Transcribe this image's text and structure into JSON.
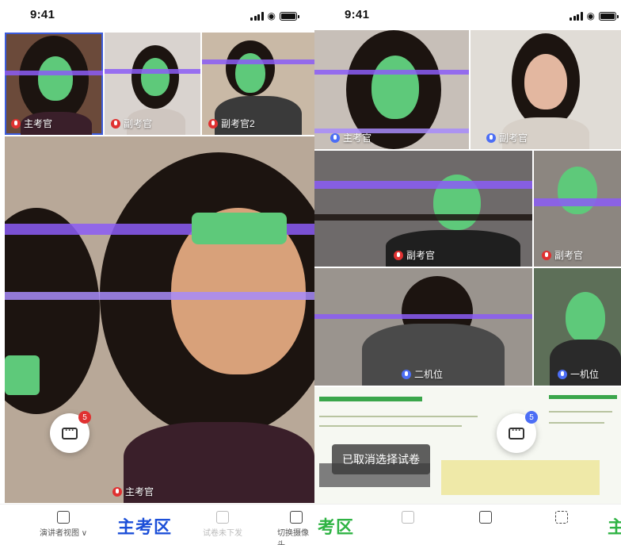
{
  "status": {
    "time": "9:41"
  },
  "left": {
    "tiles": [
      {
        "label": "主考官"
      },
      {
        "label": "副考官"
      },
      {
        "label": "副考官2"
      }
    ],
    "main_label": "主考官",
    "chat_badge": "5",
    "tabbar": {
      "view_label": "演讲者视图",
      "view_arrow": "∨",
      "zone_title": "主考区",
      "paper_label": "试卷未下发",
      "camera_label": "切换摄像头"
    }
  },
  "right": {
    "top_tiles": [
      {
        "label": "主考官"
      },
      {
        "label": "副考官"
      }
    ],
    "mid_tiles": [
      {
        "label": "副考官"
      },
      {
        "label": "副考官"
      }
    ],
    "cam_tiles": [
      {
        "label": "二机位"
      },
      {
        "label": "一机位"
      }
    ],
    "toast": "已取消选择试卷",
    "chat_badge": "5",
    "tabbar": {
      "zone_left": "考区",
      "zone_right": "主"
    }
  },
  "colors": {
    "accent": "#3b5bdb",
    "badge_red": "#e03131",
    "badge_blue": "#4c6ef5",
    "zone_blue": "#1c4fd8",
    "zone_green": "#2fb344",
    "mic_red": "#e03131",
    "mic_blue": "#4c6ef5"
  }
}
